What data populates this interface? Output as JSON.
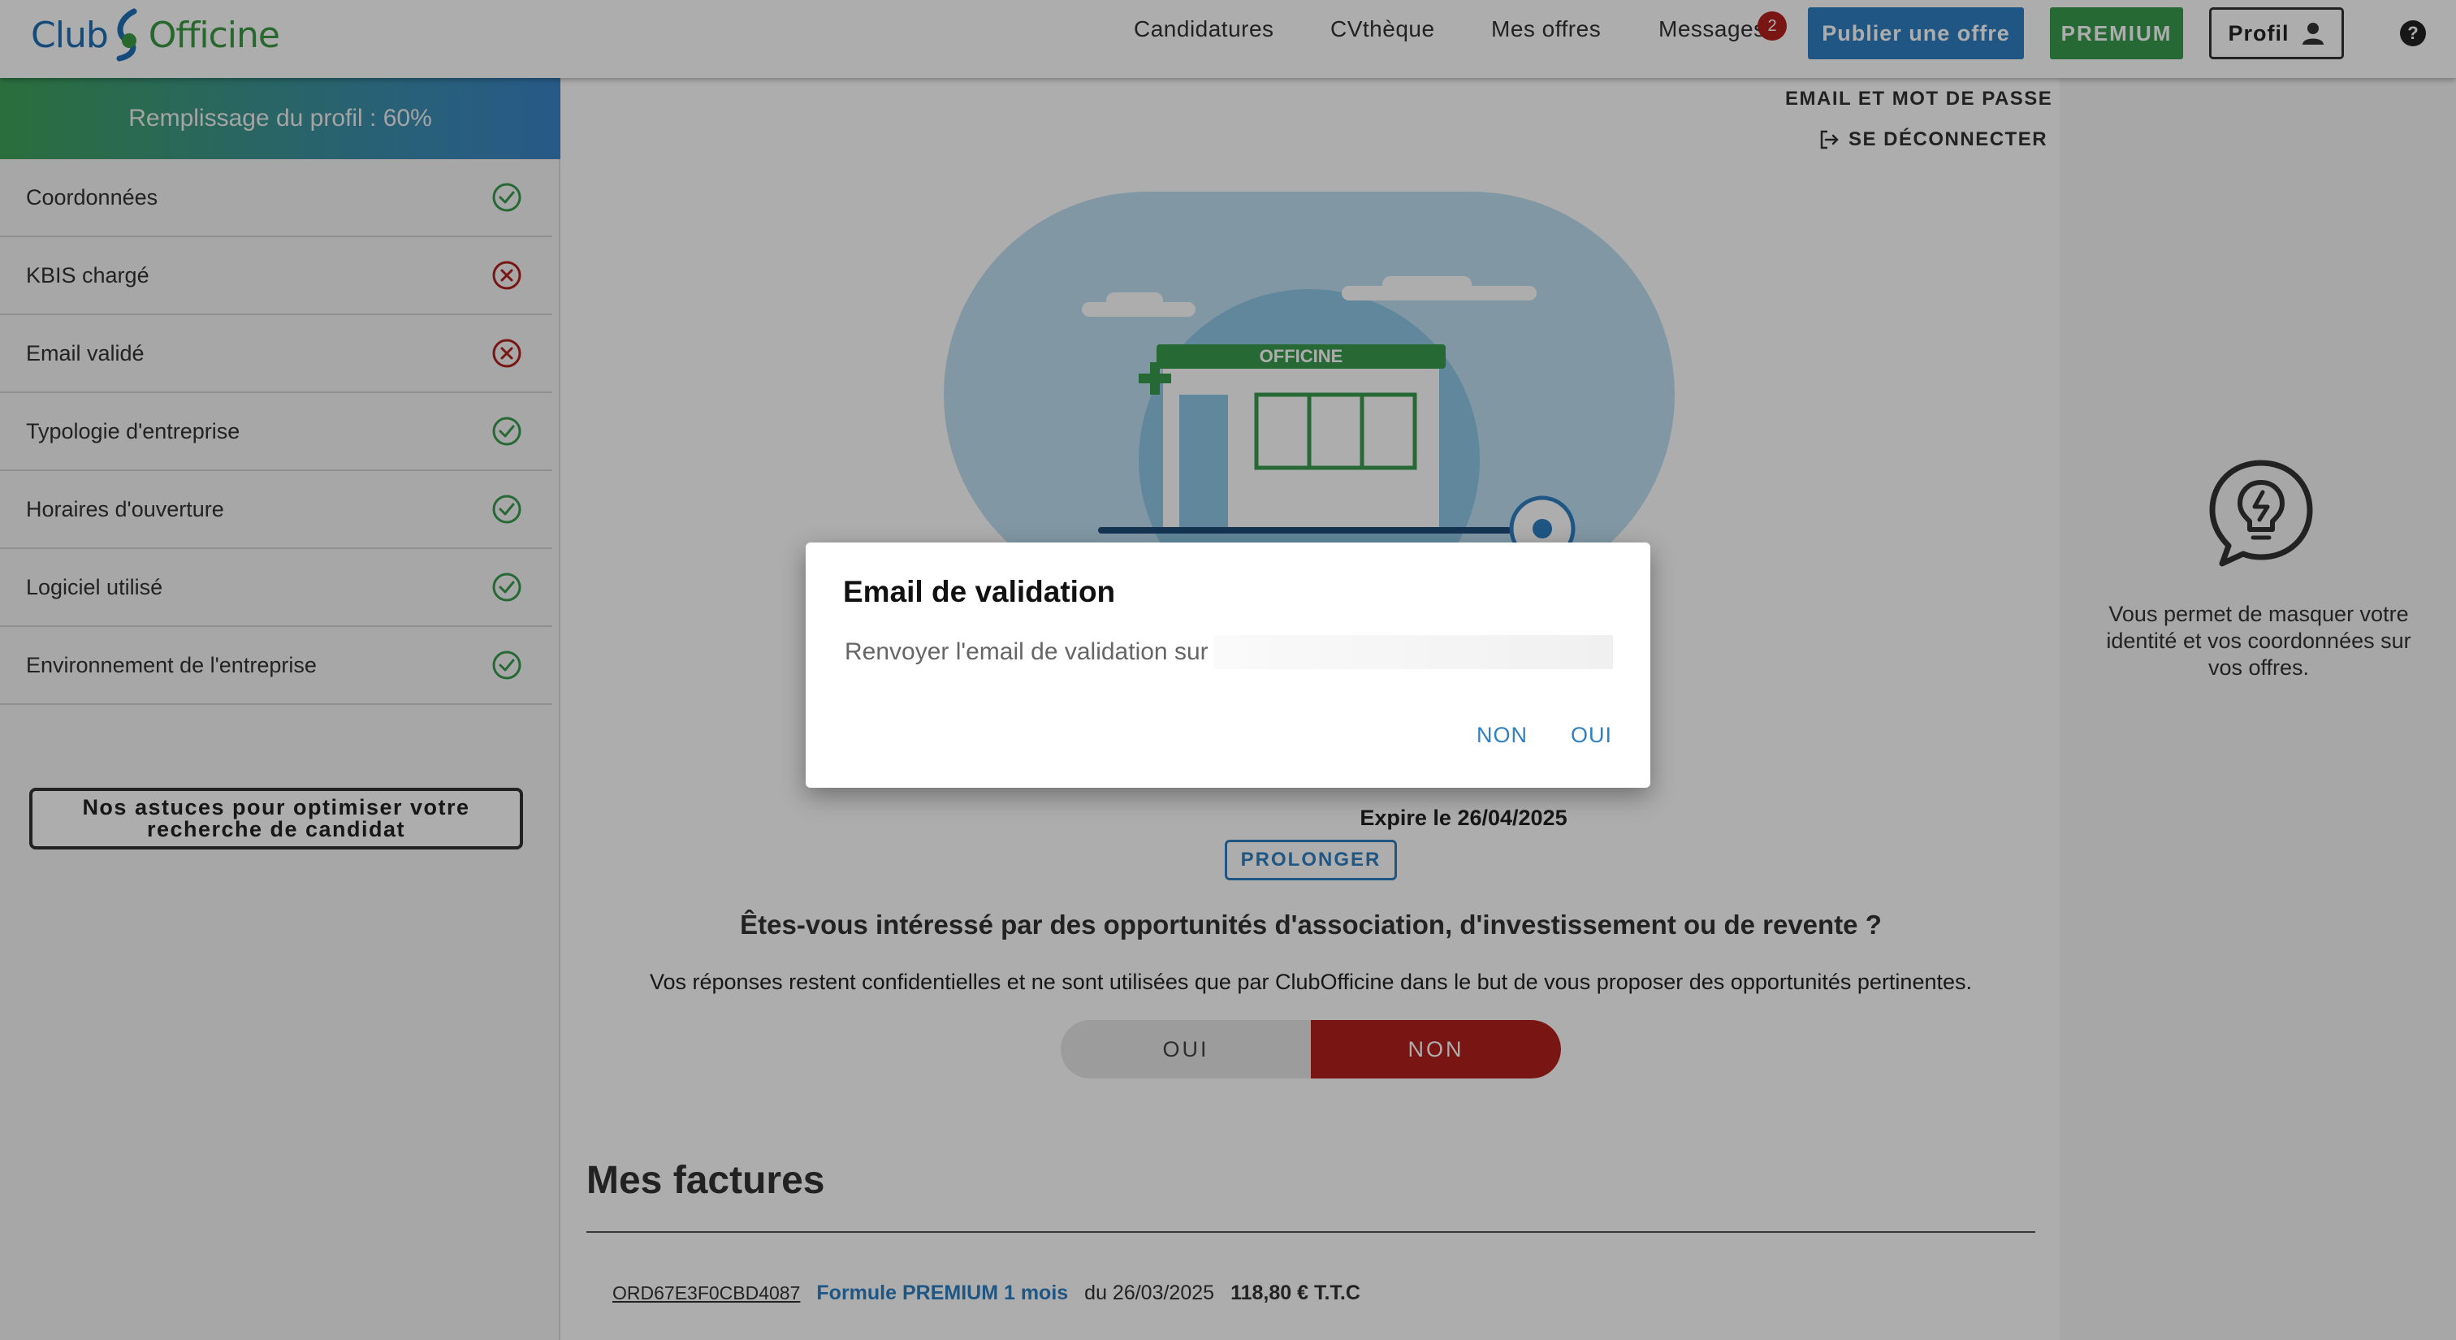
{
  "header": {
    "logo_club": "Club",
    "logo_officine": "Officine",
    "nav": {
      "candidatures": "Candidatures",
      "cvtheque": "CVthèque",
      "offres": "Mes offres",
      "messages": "Messages"
    },
    "messages_badge": "2",
    "publier_label": "Publier une offre",
    "premium_label": "PREMIUM",
    "profil_label": "Profil",
    "help_label": "?"
  },
  "sidebar": {
    "progress_label": "Remplissage du profil : 60%",
    "progress_percent": 60,
    "items": [
      {
        "label": "Coordonnées",
        "status": "ok"
      },
      {
        "label": "KBIS chargé",
        "status": "missing"
      },
      {
        "label": "Email validé",
        "status": "missing"
      },
      {
        "label": "Typologie d'entreprise",
        "status": "ok"
      },
      {
        "label": "Horaires d'ouverture",
        "status": "ok"
      },
      {
        "label": "Logiciel utilisé",
        "status": "ok"
      },
      {
        "label": "Environnement de l'entreprise",
        "status": "ok"
      }
    ],
    "tips_button": "Nos astuces pour optimiser votre recherche de candidat",
    "colors": {
      "ok": "#3a9b4e",
      "missing": "#b3211c"
    }
  },
  "main": {
    "account_email_link": "EMAIL ET MOT DE PASSE",
    "logout_link": "SE DÉCONNECTER",
    "illustration_sign": "OFFICINE",
    "expire_text": "Expire le 26/04/2025",
    "prolonger_button": "PROLONGER",
    "question": "Êtes-vous intéressé par des opportunités d'association, d'investissement ou de revente ?",
    "question_sub": "Vos réponses restent confidentielles et ne sont utilisées que par ClubOfficine dans le but de vous proposer des opportunités pertinentes.",
    "toggle": {
      "oui": "OUI",
      "non": "NON",
      "selected": "NON"
    },
    "invoices": {
      "title": "Mes factures",
      "rows": [
        {
          "ref": "ORD67E3F0CBD4087",
          "plan": "Formule PREMIUM 1 mois",
          "date": "du 26/03/2025",
          "amount": "118,80 € T.T.C"
        }
      ]
    }
  },
  "right_panel": {
    "text": "Vous permet de masquer votre identité et vos coordonnées sur vos offres."
  },
  "modal": {
    "title": "Email de validation",
    "body": "Renvoyer l'email de validation sur",
    "non_label": "NON",
    "oui_label": "OUI"
  }
}
